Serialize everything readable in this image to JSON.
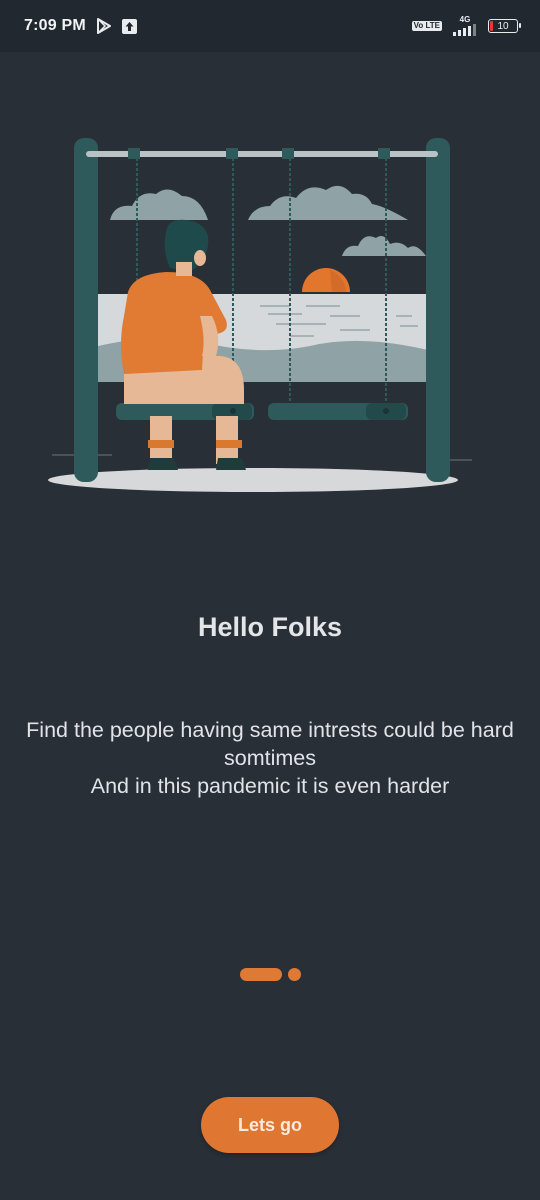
{
  "status_bar": {
    "time": "7:09 PM",
    "volte": "Vo LTE",
    "network": "4G",
    "battery": "10"
  },
  "onboarding": {
    "title": "Hello Folks",
    "description_lines": [
      "Find the people having same intrests could be hard",
      "somtimes",
      "And in this pandemic it is even harder"
    ],
    "page_indicator": {
      "total": 2,
      "current": 1
    },
    "cta_label": "Lets go"
  },
  "colors": {
    "background": "#292f37",
    "status_bar": "#222830",
    "accent": "#df7732",
    "swing_frame": "#2e5a5b",
    "cloud": "#8fa3a6",
    "sea": "#d6d9dc"
  },
  "icons": [
    "play-store-icon",
    "upload-icon",
    "signal-icon",
    "battery-icon"
  ],
  "illustration": {
    "name": "person-on-swing-illustration"
  }
}
